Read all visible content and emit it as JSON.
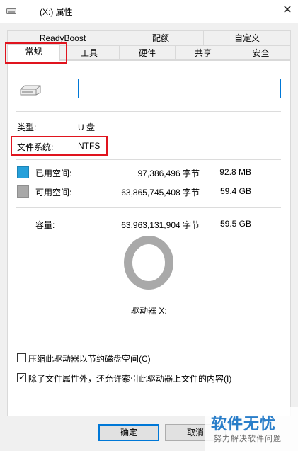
{
  "window": {
    "title": "(X:) 属性",
    "close_glyph": "✕",
    "drive_icon": "usb-drive-icon"
  },
  "tabs": {
    "row1": [
      {
        "label": "ReadyBoost"
      },
      {
        "label": "配额"
      },
      {
        "label": "自定义"
      }
    ],
    "row2": [
      {
        "label": "常规",
        "active": true
      },
      {
        "label": "工具"
      },
      {
        "label": "硬件"
      },
      {
        "label": "共享"
      },
      {
        "label": "安全"
      }
    ]
  },
  "general": {
    "drive_name_value": "",
    "type_label": "类型:",
    "type_value": "U 盘",
    "fs_label": "文件系统:",
    "fs_value": "NTFS",
    "used_label": "已用空间:",
    "used_bytes": "97,386,496 字节",
    "used_size": "92.8 MB",
    "free_label": "可用空间:",
    "free_bytes": "63,865,745,408 字节",
    "free_size": "59.4 GB",
    "capacity_label": "容量:",
    "capacity_bytes": "63,963,131,904 字节",
    "capacity_size": "59.5 GB",
    "drive_letter_label": "驱动器 X:",
    "used_fraction": 0.0015
  },
  "options": {
    "compress_label": "压缩此驱动器以节约磁盘空间(C)",
    "compress_checked": false,
    "index_label": "除了文件属性外，还允许索引此驱动器上文件的内容(I)",
    "index_checked": true
  },
  "buttons": {
    "ok": "确定",
    "cancel": "取消"
  },
  "colors": {
    "used": "#26a0da",
    "free": "#a9a9a9",
    "highlight": "#e0141e",
    "focus": "#0078d7"
  },
  "watermark": {
    "main": "软件无忧",
    "sub": "努力解决软件问题"
  }
}
